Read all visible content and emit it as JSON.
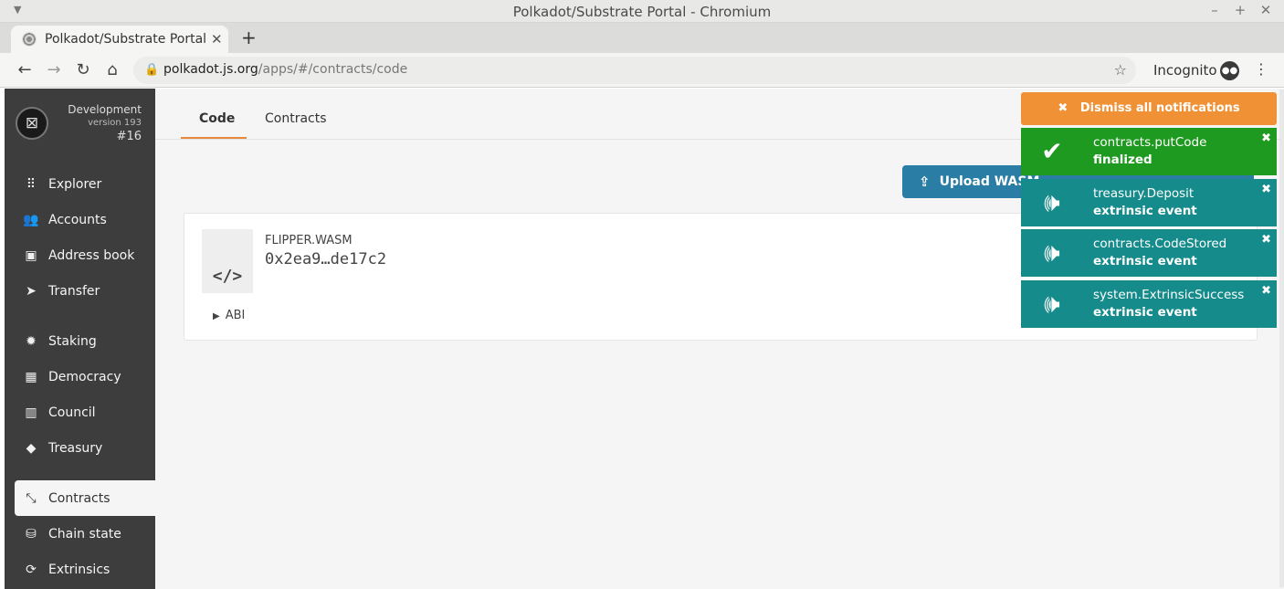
{
  "window": {
    "title": "Polkadot/Substrate Portal - Chromium",
    "controls": [
      "–",
      "+",
      "✕"
    ]
  },
  "browser": {
    "tab_title": "Polkadot/Substrate Portal",
    "new_tab": "+",
    "url_host": "polkadot.js.org",
    "url_path": "/apps/#/contracts/code",
    "profile_label": "Incognito"
  },
  "chain": {
    "name": "Development",
    "version": "version 193",
    "block": "#16"
  },
  "sidebar": {
    "items": [
      {
        "label": "Explorer",
        "icon": "⠿"
      },
      {
        "label": "Accounts",
        "icon": "👥"
      },
      {
        "label": "Address book",
        "icon": "▣"
      },
      {
        "label": "Transfer",
        "icon": "➤"
      },
      {
        "label": "Staking",
        "icon": "✹"
      },
      {
        "label": "Democracy",
        "icon": "▦"
      },
      {
        "label": "Council",
        "icon": "▥"
      },
      {
        "label": "Treasury",
        "icon": "◆"
      },
      {
        "label": "Contracts",
        "icon": "⤡"
      },
      {
        "label": "Chain state",
        "icon": "⛁"
      },
      {
        "label": "Extrinsics",
        "icon": "⟳"
      }
    ]
  },
  "tabs": [
    {
      "label": "Code"
    },
    {
      "label": "Contracts"
    }
  ],
  "actions": {
    "upload_label": "Upload WASM"
  },
  "code_card": {
    "icon": "</>",
    "name": "FLIPPER.WASM",
    "hash": "0x2ea9…de17c2",
    "abi_label": "ABI"
  },
  "notifications": {
    "dismiss_label": "Dismiss all notifications",
    "items": [
      {
        "title": "contracts.putCode",
        "status": "finalized",
        "color": "#1f9a21"
      },
      {
        "title": "treasury.Deposit",
        "status": "extrinsic event",
        "color": "#168b8b"
      },
      {
        "title": "contracts.CodeStored",
        "status": "extrinsic event",
        "color": "#168b8b"
      },
      {
        "title": "system.ExtrinsicSuccess",
        "status": "extrinsic event",
        "color": "#168b8b"
      }
    ]
  },
  "colors": {
    "sidebar_bg": "#3d3d3d",
    "accent": "#e6893d",
    "button_blue": "#2a7ea5",
    "dismiss_orange": "#f19135"
  }
}
